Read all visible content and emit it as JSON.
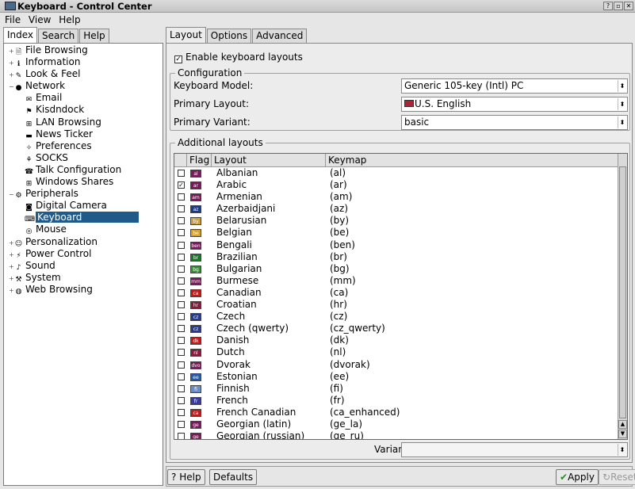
{
  "window": {
    "title": "Keyboard - Control Center",
    "controls": [
      "?",
      "▫",
      "✕"
    ]
  },
  "menu": [
    "File",
    "View",
    "Help"
  ],
  "left_tabs": [
    "Index",
    "Search",
    "Help"
  ],
  "tree": [
    {
      "label": "File Browsing",
      "level": 0,
      "icon": "file-browsing-icon",
      "glyph": "🗎"
    },
    {
      "label": "Information",
      "level": 0,
      "icon": "information-icon",
      "glyph": "ℹ"
    },
    {
      "label": "Look & Feel",
      "level": 0,
      "icon": "look-feel-icon",
      "glyph": "✎"
    },
    {
      "label": "Network",
      "level": 0,
      "icon": "network-icon",
      "glyph": "●",
      "expanded": true
    },
    {
      "label": "Email",
      "level": 1,
      "icon": "email-icon",
      "glyph": "✉"
    },
    {
      "label": "Kisdndock",
      "level": 1,
      "icon": "kisdndock-icon",
      "glyph": "⚑"
    },
    {
      "label": "LAN Browsing",
      "level": 1,
      "icon": "lan-browsing-icon",
      "glyph": "⊞"
    },
    {
      "label": "News Ticker",
      "level": 1,
      "icon": "news-ticker-icon",
      "glyph": "▬"
    },
    {
      "label": "Preferences",
      "level": 1,
      "icon": "preferences-icon",
      "glyph": "✧"
    },
    {
      "label": "SOCKS",
      "level": 1,
      "icon": "socks-icon",
      "glyph": "⚘"
    },
    {
      "label": "Talk Configuration",
      "level": 1,
      "icon": "talk-configuration-icon",
      "glyph": "☎"
    },
    {
      "label": "Windows Shares",
      "level": 1,
      "icon": "windows-shares-icon",
      "glyph": "⊞"
    },
    {
      "label": "Peripherals",
      "level": 0,
      "icon": "peripherals-icon",
      "glyph": "⚙",
      "expanded": true
    },
    {
      "label": "Digital Camera",
      "level": 1,
      "icon": "digital-camera-icon",
      "glyph": "◙"
    },
    {
      "label": "Keyboard",
      "level": 1,
      "icon": "keyboard-icon",
      "glyph": "⌨",
      "selected": true
    },
    {
      "label": "Mouse",
      "level": 1,
      "icon": "mouse-icon",
      "glyph": "◎"
    },
    {
      "label": "Personalization",
      "level": 0,
      "icon": "personalization-icon",
      "glyph": "☺"
    },
    {
      "label": "Power Control",
      "level": 0,
      "icon": "power-control-icon",
      "glyph": "⚡"
    },
    {
      "label": "Sound",
      "level": 0,
      "icon": "sound-icon",
      "glyph": "♪"
    },
    {
      "label": "System",
      "level": 0,
      "icon": "system-icon",
      "glyph": "⚒"
    },
    {
      "label": "Web Browsing",
      "level": 0,
      "icon": "web-browsing-icon",
      "glyph": "◍"
    }
  ],
  "right_tabs": [
    "Layout",
    "Options",
    "Advanced"
  ],
  "enable": {
    "label": "Enable keyboard layouts",
    "checked": true
  },
  "configuration": {
    "title": "Configuration",
    "model_label": "Keyboard Model:",
    "model_value": "Generic 105-key (Intl) PC",
    "primary_layout_label": "Primary Layout:",
    "primary_layout_value": "U.S. English",
    "primary_variant_label": "Primary Variant:",
    "primary_variant_value": "basic"
  },
  "additional": {
    "title": "Additional layouts",
    "columns": [
      "Flag",
      "Layout",
      "Keymap"
    ],
    "rows": [
      {
        "layout": "Albanian",
        "keymap": "(al)",
        "flag": "al",
        "color": "#7a1a5a",
        "checked": false
      },
      {
        "layout": "Arabic",
        "keymap": "(ar)",
        "flag": "ar",
        "color": "#7a1a5a",
        "checked": true
      },
      {
        "layout": "Armenian",
        "keymap": "(am)",
        "flag": "am",
        "color": "#7a1a5a",
        "checked": false
      },
      {
        "layout": "Azerbaidjani",
        "keymap": "(az)",
        "flag": "az",
        "color": "#1a3a8a",
        "checked": false
      },
      {
        "layout": "Belarusian",
        "keymap": "(by)",
        "flag": "by",
        "color": "#c8a040",
        "checked": false
      },
      {
        "layout": "Belgian",
        "keymap": "(be)",
        "flag": "be",
        "color": "#d8a020",
        "checked": false
      },
      {
        "layout": "Bengali",
        "keymap": "(ben)",
        "flag": "ben",
        "color": "#7a1a5a",
        "checked": false
      },
      {
        "layout": "Brazilian",
        "keymap": "(br)",
        "flag": "br",
        "color": "#1a7a2a",
        "checked": false
      },
      {
        "layout": "Bulgarian",
        "keymap": "(bg)",
        "flag": "bg",
        "color": "#3a8a3a",
        "checked": false
      },
      {
        "layout": "Burmese",
        "keymap": "(mm)",
        "flag": "mm",
        "color": "#7a1a5a",
        "checked": false
      },
      {
        "layout": "Canadian",
        "keymap": "(ca)",
        "flag": "ca",
        "color": "#c01a1a",
        "checked": false
      },
      {
        "layout": "Croatian",
        "keymap": "(hr)",
        "flag": "hr",
        "color": "#8a1a3a",
        "checked": false
      },
      {
        "layout": "Czech",
        "keymap": "(cz)",
        "flag": "cz",
        "color": "#2a3a8a",
        "checked": false
      },
      {
        "layout": "Czech (qwerty)",
        "keymap": "(cz_qwerty)",
        "flag": "cz",
        "color": "#2a3a8a",
        "checked": false
      },
      {
        "layout": "Danish",
        "keymap": "(dk)",
        "flag": "dk",
        "color": "#c01a1a",
        "checked": false
      },
      {
        "layout": "Dutch",
        "keymap": "(nl)",
        "flag": "nl",
        "color": "#8a1a3a",
        "checked": false
      },
      {
        "layout": "Dvorak",
        "keymap": "(dvorak)",
        "flag": "dvo",
        "color": "#7a1a5a",
        "checked": false
      },
      {
        "layout": "Estonian",
        "keymap": "(ee)",
        "flag": "ee",
        "color": "#2a5aaa",
        "checked": false
      },
      {
        "layout": "Finnish",
        "keymap": "(fi)",
        "flag": "fi",
        "color": "#6a8ac8",
        "checked": false
      },
      {
        "layout": "French",
        "keymap": "(fr)",
        "flag": "fr",
        "color": "#3a3a9a",
        "checked": false
      },
      {
        "layout": "French Canadian",
        "keymap": "(ca_enhanced)",
        "flag": "ca",
        "color": "#c01a1a",
        "checked": false
      },
      {
        "layout": "Georgian (latin)",
        "keymap": "(ge_la)",
        "flag": "ge",
        "color": "#7a1a5a",
        "checked": false
      },
      {
        "layout": "Georgian (russian)",
        "keymap": "(ge_ru)",
        "flag": "ge",
        "color": "#7a1a5a",
        "checked": false
      }
    ],
    "variant_label": "Variant:",
    "variant_value": ""
  },
  "buttons": {
    "help": "Help",
    "defaults": "Defaults",
    "apply": "Apply",
    "reset": "Reset"
  }
}
